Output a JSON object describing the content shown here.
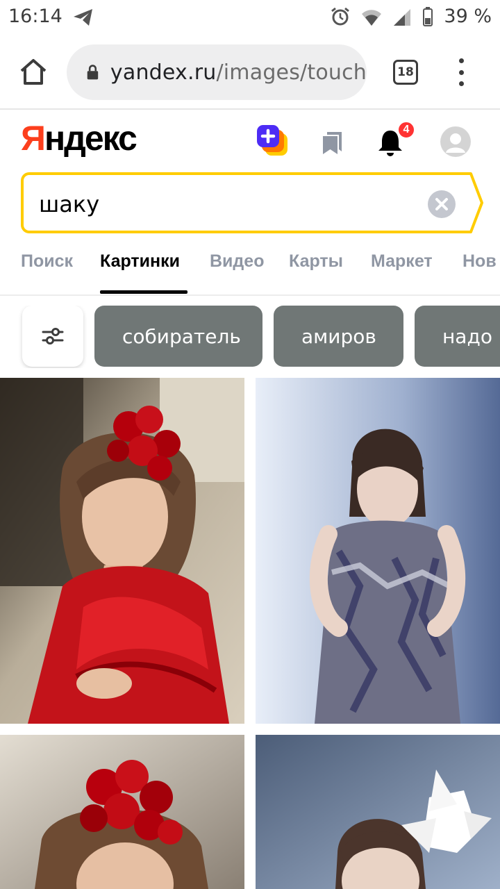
{
  "status_bar": {
    "time": "16:14",
    "battery": "39 %",
    "icons": [
      "telegram-icon",
      "alarm-icon",
      "wifi-icon",
      "signal-icon",
      "battery-icon"
    ]
  },
  "browser": {
    "url_host": "yandex.ru",
    "url_path": "/images/touch",
    "tab_count": "18"
  },
  "header": {
    "logo_first": "Я",
    "logo_rest": "ндекс",
    "notifications_count": "4"
  },
  "search": {
    "query": "шаку"
  },
  "tabs": [
    {
      "label": "Поиск",
      "active": false
    },
    {
      "label": "Картинки",
      "active": true
    },
    {
      "label": "Видео",
      "active": false
    },
    {
      "label": "Карты",
      "active": false
    },
    {
      "label": "Маркет",
      "active": false
    },
    {
      "label": "Нов",
      "active": false
    }
  ],
  "chips": [
    {
      "label": "собиратель"
    },
    {
      "label": "амиров"
    },
    {
      "label": "надо н"
    }
  ],
  "colors": {
    "accent_yellow": "#ffcc00",
    "logo_red": "#fc3f1d",
    "chip_bg": "#707776",
    "tab_inactive": "#8f96a3"
  }
}
